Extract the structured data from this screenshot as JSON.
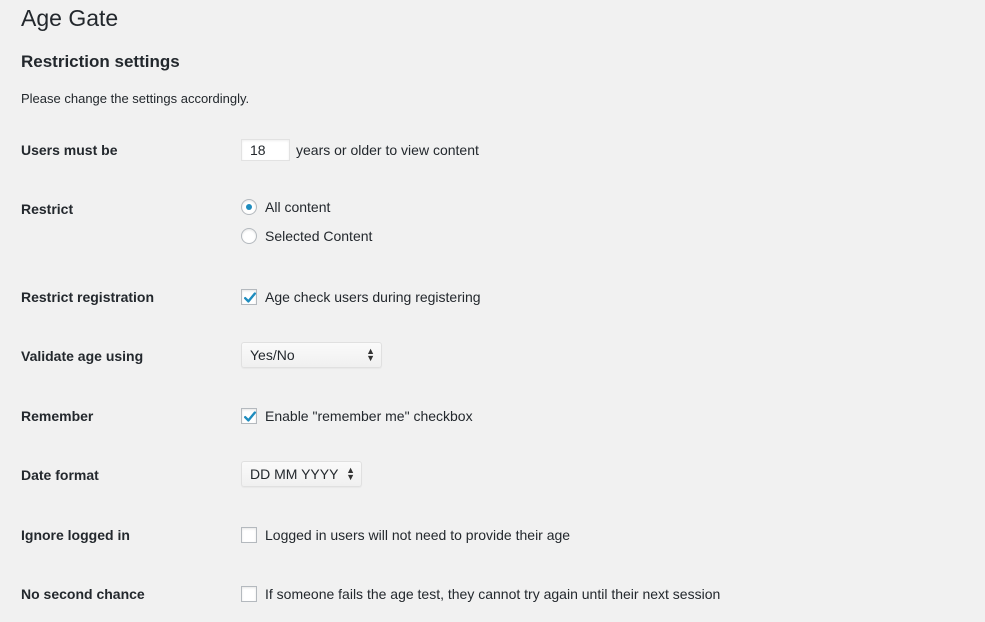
{
  "page": {
    "title": "Age Gate",
    "section_title": "Restriction settings",
    "description": "Please change the settings accordingly."
  },
  "rows": {
    "min_age": {
      "label": "Users must be",
      "value": "18",
      "suffix": "years or older to view content"
    },
    "restrict": {
      "label": "Restrict",
      "options": [
        {
          "label": "All content",
          "checked": true
        },
        {
          "label": "Selected Content",
          "checked": false
        }
      ]
    },
    "restrict_registration": {
      "label": "Restrict registration",
      "checkbox_label": "Age check users during registering",
      "checked": true
    },
    "validate_age": {
      "label": "Validate age using",
      "selected": "Yes/No"
    },
    "remember": {
      "label": "Remember",
      "checkbox_label": "Enable \"remember me\" checkbox",
      "checked": true
    },
    "date_format": {
      "label": "Date format",
      "selected": "DD MM YYYY"
    },
    "ignore_logged_in": {
      "label": "Ignore logged in",
      "checkbox_label": "Logged in users will not need to provide their age",
      "checked": false
    },
    "no_second_chance": {
      "label": "No second chance",
      "checkbox_label": "If someone fails the age test, they cannot try again until their next session",
      "checked": false
    }
  },
  "icons": {
    "checkmark": "checkmark-icon",
    "select_arrows": "up-down-arrows-icon"
  },
  "colors": {
    "background": "#f1f1f1",
    "text": "#23282d",
    "accent": "#1e8cbe"
  }
}
